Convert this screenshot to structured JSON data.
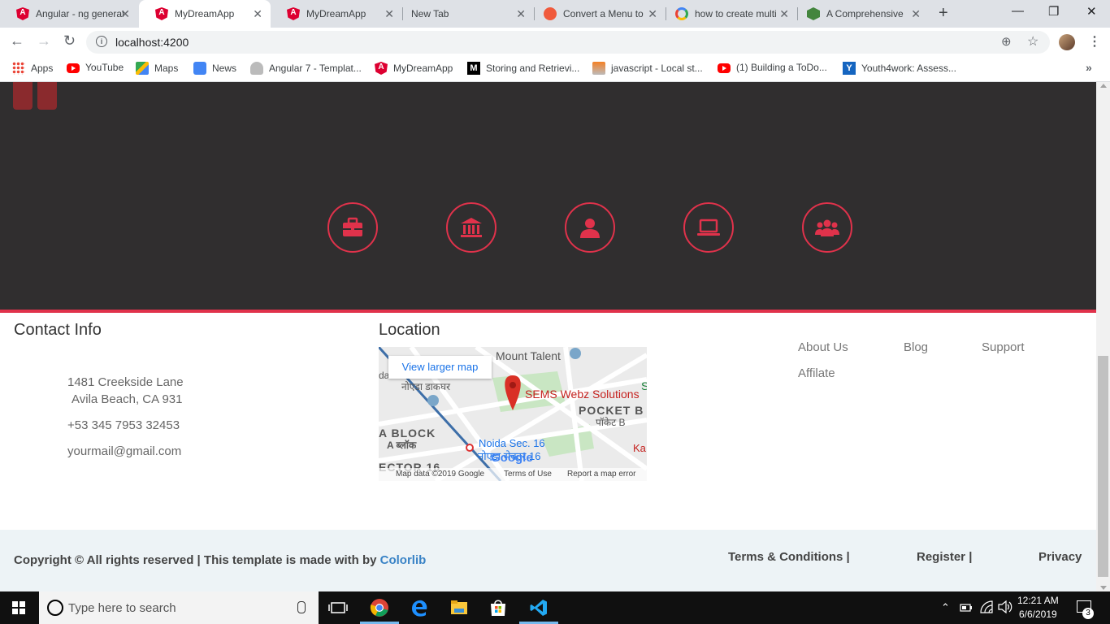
{
  "browser": {
    "tabs": [
      {
        "title": "Angular - ng generate",
        "icon": "angular-icon",
        "active": false
      },
      {
        "title": "MyDreamApp",
        "icon": "angular-icon",
        "active": true
      },
      {
        "title": "MyDreamApp",
        "icon": "angular-icon",
        "active": false
      },
      {
        "title": "New Tab",
        "icon": "",
        "active": false
      },
      {
        "title": "Convert a Menu to",
        "icon": "convert-icon",
        "active": false
      },
      {
        "title": "how to create multi",
        "icon": "google-icon",
        "active": false
      },
      {
        "title": "A Comprehensive",
        "icon": "node-icon",
        "active": false
      }
    ],
    "tab_close": "✕",
    "new_tab": "+",
    "window_controls": {
      "minimize": "—",
      "restore": "❐",
      "close": "✕"
    },
    "nav": {
      "back": "←",
      "forward": "→",
      "reload": "↻"
    },
    "url": "localhost:4200",
    "bookmarks": [
      {
        "label": "Apps"
      },
      {
        "label": "YouTube"
      },
      {
        "label": "Maps"
      },
      {
        "label": "News"
      },
      {
        "label": "Angular 7 - Templat..."
      },
      {
        "label": "MyDreamApp"
      },
      {
        "label": "Storing and Retrievi..."
      },
      {
        "label": "javascript - Local st..."
      },
      {
        "label": "(1) Building a ToDo..."
      },
      {
        "label": "Youth4work: Assess..."
      }
    ],
    "bookmarks_more": "»"
  },
  "page": {
    "accent_color": "#e0324b",
    "dark_bg_color": "#302e2f",
    "feature_icons": [
      "briefcase-icon",
      "bank-icon",
      "user-icon",
      "laptop-icon",
      "users-icon"
    ],
    "contact": {
      "heading": "Contact Info",
      "address_line1": "1481 Creekside Lane",
      "address_line2": "Avila Beach, CA 931",
      "phone": "+53 345 7953 32453",
      "email": "yourmail@gmail.com"
    },
    "location": {
      "heading": "Location",
      "view_larger": "View larger map",
      "labels": {
        "mount_talent": "Mount Talent",
        "da": "da",
        "post_office": "नोएडा डाकघर",
        "pin": "SEMS Webz Solutions",
        "pocket_b": "POCKET B",
        "pocket_b_hindi": "पॉकेट B",
        "a_block": "A BLOCK",
        "a_block_hindi": "A ब्लॉक",
        "metro": "Noida Sec. 16",
        "metro_hindi": "नोएडा सेक्टर 16",
        "sector": "ECTOR 16",
        "ka": "Ka",
        "s": "S",
        "google": "Google"
      },
      "attribution": {
        "map_data": "Map data ©2019 Google",
        "terms": "Terms of Use",
        "report": "Report a map error"
      }
    },
    "links": [
      "About Us",
      "Blog",
      "Support",
      "Affilate"
    ],
    "bottom": {
      "copyright": "Copyright © All rights reserved | This template is made with  by ",
      "colorlib": "Colorlib",
      "terms": "Terms & Conditions  |",
      "register": "Register  |",
      "privacy": "Privacy"
    }
  },
  "taskbar": {
    "search_placeholder": "Type here to search",
    "time": "12:21 AM",
    "date": "6/6/2019",
    "notifications": "3"
  }
}
